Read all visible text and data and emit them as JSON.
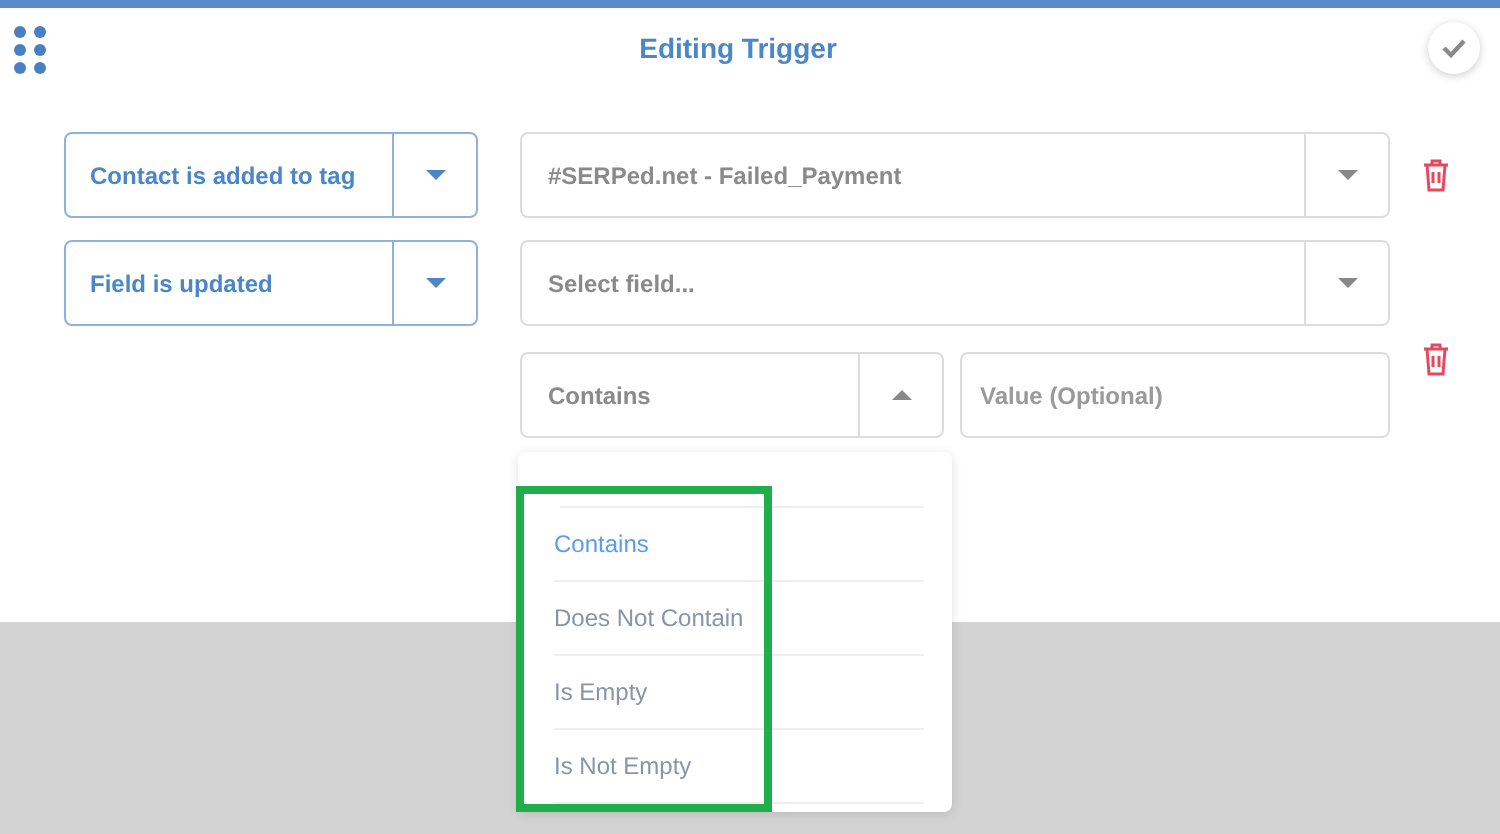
{
  "header": {
    "title": "Editing Trigger"
  },
  "triggers": [
    {
      "event": "Contact is added to tag",
      "value": "#SERPed.net - Failed_Payment"
    },
    {
      "event": "Field is updated",
      "field_placeholder": "Select field...",
      "condition": "Contains",
      "condition_open": true,
      "value_placeholder": "Value (Optional)",
      "condition_options": [
        {
          "label": "Contains",
          "selected": true
        },
        {
          "label": "Does Not Contain",
          "selected": false
        },
        {
          "label": "Is Empty",
          "selected": false
        },
        {
          "label": "Is Not Empty",
          "selected": false
        }
      ]
    }
  ]
}
